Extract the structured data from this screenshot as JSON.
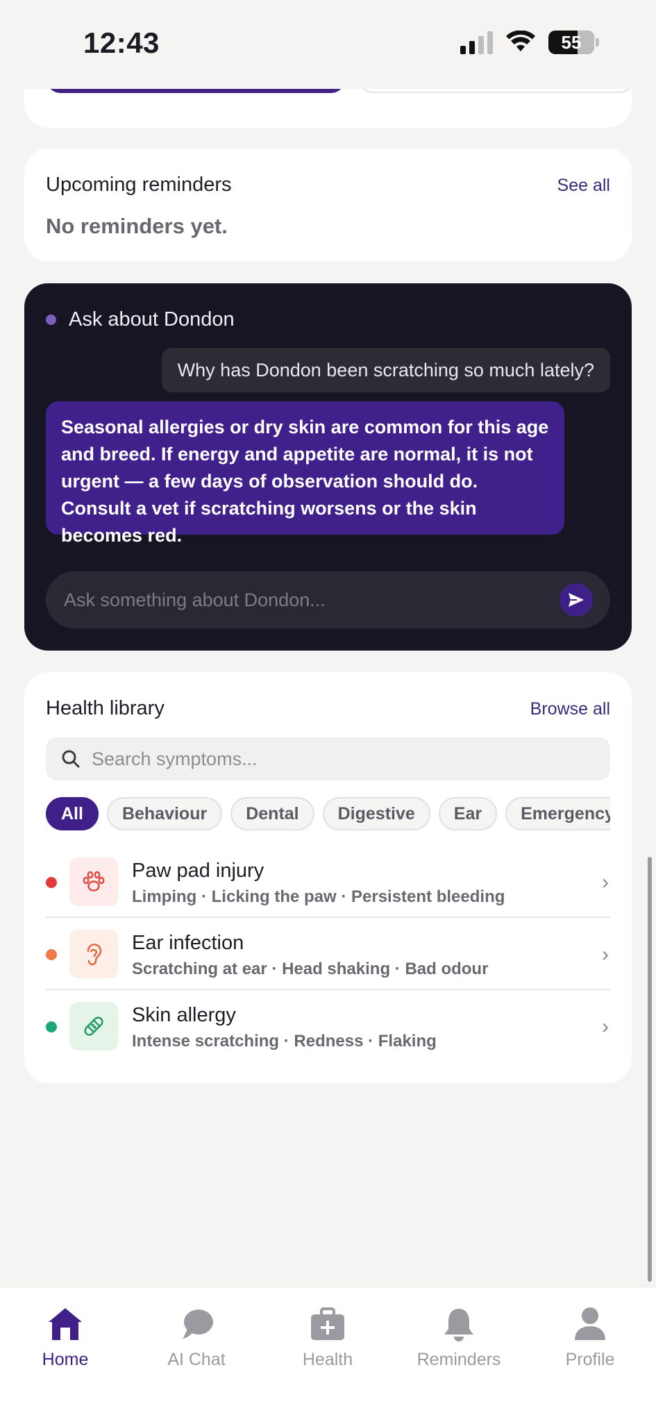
{
  "status_bar": {
    "time": "12:43",
    "battery": "55"
  },
  "reminders": {
    "title": "Upcoming reminders",
    "see_all": "See all",
    "empty": "No reminders yet."
  },
  "ai": {
    "title": "Ask about Dondon",
    "user_message": "Why has Dondon been scratching so much lately?",
    "assistant_message": "Seasonal allergies or dry skin are common for this age and breed. If energy and appetite are normal, it is not urgent — a few days of observation should do. Consult a vet if scratching worsens or the skin becomes red.",
    "input_placeholder": "Ask something about Dondon..."
  },
  "library": {
    "title": "Health library",
    "browse_all": "Browse all",
    "search_placeholder": "Search symptoms...",
    "chips": [
      "All",
      "Behaviour",
      "Dental",
      "Digestive",
      "Ear",
      "Emergency"
    ],
    "items": [
      {
        "name": "Paw pad injury",
        "symptoms": "Limping · Licking the paw · Persistent bleeding",
        "icon": "paw-icon",
        "dot_color": "#e23b3b"
      },
      {
        "name": "Ear infection",
        "symptoms": "Scratching at ear · Head shaking · Bad odour",
        "icon": "ear-icon",
        "dot_color": "#f07a4a"
      },
      {
        "name": "Skin allergy",
        "symptoms": "Intense scratching · Redness · Flaking",
        "icon": "bandage-icon",
        "dot_color": "#1ea57a"
      }
    ]
  },
  "nav": {
    "items": [
      {
        "label": "Home",
        "icon": "home-icon",
        "active": true
      },
      {
        "label": "AI Chat",
        "icon": "chat-icon",
        "active": false
      },
      {
        "label": "Health",
        "icon": "medical-kit-icon",
        "active": false
      },
      {
        "label": "Reminders",
        "icon": "bell-icon",
        "active": false
      },
      {
        "label": "Profile",
        "icon": "person-icon",
        "active": false
      }
    ]
  },
  "colors": {
    "accent": "#3f1f88",
    "dark_card": "#171524",
    "inactive_nav": "#9c9aa0"
  }
}
